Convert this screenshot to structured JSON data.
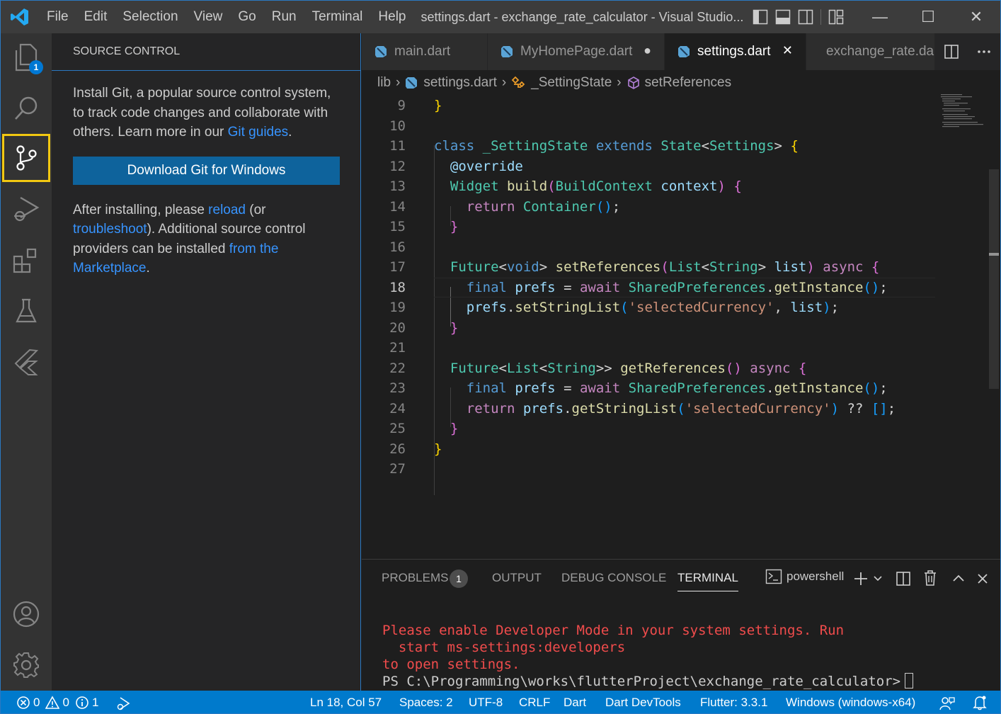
{
  "titlebar": {
    "menu": [
      "File",
      "Edit",
      "Selection",
      "View",
      "Go",
      "Run",
      "Terminal",
      "Help"
    ],
    "title": "settings.dart - exchange_rate_calculator - Visual Studio...",
    "minimize": "—",
    "maximize": "☐",
    "close": "✕"
  },
  "activitybar": {
    "explorer_badge": "1",
    "items": [
      "explorer-icon",
      "search-icon",
      "source-control-icon",
      "run-debug-icon",
      "extensions-icon",
      "testing-icon",
      "flutter-icon",
      "accounts-icon",
      "settings-gear-icon"
    ]
  },
  "sidebar": {
    "header": "SOURCE CONTROL",
    "intro_1": "Install Git, a popular source control system, to track code changes and collaborate with others. Learn more in our ",
    "git_guides_link": "Git guides",
    "intro_2": ".",
    "download_button": "Download Git for Windows",
    "after_1": "After installing, please ",
    "reload_link": "reload",
    "after_2": " (or ",
    "troubleshoot_link": "troubleshoot",
    "after_3": "). Additional source control providers can be installed ",
    "marketplace_link": "from the Marketplace",
    "after_4": "."
  },
  "tabs": [
    {
      "label": "main.dart",
      "state": ""
    },
    {
      "label": "MyHomePage.dart",
      "state": "●"
    },
    {
      "label": "settings.dart",
      "state": "✕"
    },
    {
      "label": "exchange_rate.dart",
      "state": ""
    }
  ],
  "breadcrumbs": {
    "folder": "lib",
    "file": "settings.dart",
    "class": "_SettingState",
    "method": "setReferences"
  },
  "editor": {
    "current_line": 18,
    "line_numbers": [
      "9",
      "10",
      "11",
      "12",
      "13",
      "14",
      "15",
      "16",
      "17",
      "18",
      "19",
      "20",
      "21",
      "22",
      "23",
      "24",
      "25",
      "26",
      "27"
    ]
  },
  "panel": {
    "tabs": [
      "PROBLEMS",
      "OUTPUT",
      "DEBUG CONSOLE",
      "TERMINAL"
    ],
    "problems_count": "1",
    "active_tab": "TERMINAL",
    "shell": "powershell",
    "terminal_lines": [
      "Please enable Developer Mode in your system settings. Run",
      "  start ms-settings:developers",
      "to open settings."
    ],
    "prompt": "PS C:\\Programming\\works\\flutterProject\\exchange_rate_calculator>"
  },
  "statusbar": {
    "errors": "0",
    "warnings": "0",
    "infos": "1",
    "position": "Ln 18, Col 57",
    "spaces": "Spaces: 2",
    "encoding": "UTF-8",
    "eol": "CRLF",
    "language": "Dart",
    "devtools": "Dart DevTools",
    "flutter": "Flutter: 3.3.1",
    "device": "Windows (windows-x64)"
  },
  "colors": {
    "accent": "#007acc",
    "active_highlight": "#f2c811",
    "button": "#0e639c",
    "link": "#3794ff",
    "terminal_warning": "#f14c4c"
  }
}
